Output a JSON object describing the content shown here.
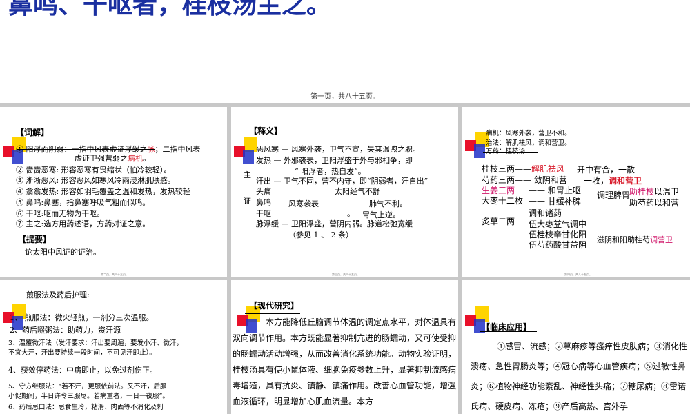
{
  "top": {
    "title": "鼻鸣、干呕者，桂枝汤主之。",
    "page": "第一页，共八十五页。"
  },
  "slide2": {
    "heading": "【词解】",
    "l1a": "① 阳浮而阴弱：一指中风表虚证浮缓之",
    "l1b": "脉",
    "l1c": "；二指中风表",
    "l2a": "虚证卫强营弱之",
    "l2b": "病机",
    "l2c": "。",
    "l3": "② 啬啬恶寒:     形容恶寒有畏缩状（怕冷较轻）。",
    "l4": "③ 淅淅恶风:     形容恶风如寒风冷雨浸淋肌肤感。",
    "l5": "④ 翕翕发热:     形容如羽毛覆盖之温和发热，发热较轻",
    "l6": "⑤ 鼻鸣:鼻塞，指鼻塞呼吸气粗而似鸣。",
    "l7": "⑥ 干呕:呕而无物为干呕。",
    "l8": "⑦ 主之:选方用药述语，方药对证之意。",
    "heading2": "【提要】",
    "l9": "论太阳中风证的证治。",
    "foot": "第二页，共八十五页。"
  },
  "slide3": {
    "heading": "【释义】",
    "zhu": "主",
    "zheng": "证",
    "r1": "恶风寒 — 风寒外袭，卫气不宣，失其温煦之职。",
    "r2": "发热  — 外邪袭表，卫阳浮盛于外与邪相争，即",
    "r3": "“ 阳浮者，热自发”。",
    "r4": "汗出 — 卫气不固，营不内守，即“阴弱者，汗自出”",
    "r5a": "头痛",
    "r5b": "太阳经气不舒",
    "r6a": "鼻鸣",
    "r6b": "风寒袭表",
    "r6c": "肺气不利。",
    "r7a": "干呕",
    "r7b": "。",
    "r7c": "胃气上逆。",
    "r8": "脉浮缓 — 卫阳浮盛，营阴内弱。脉道松弛宽缓",
    "r9": "（参见 1 、 2 条）",
    "foot": "第三页，共八十五页。"
  },
  "slide4": {
    "n1": "病机：风寒外袭，营卫不和。",
    "n2": "治法：解肌祛风，调和营卫。",
    "n3": "方药：桂枝汤",
    "a1": "桂枝三两——",
    "a1r": "解肌祛风",
    "a1c": "开中有合，一散",
    "a2": "芍药三两—— 敛阴和营",
    "a2c": "一收，",
    "a2r": "调和营卫",
    "a3p": "生姜三两",
    "a3": "—— 和胃止呕",
    "a3c": "调理脾胃",
    "a3r": "助桂枝",
    "a3d": "以温卫",
    "a4": "大枣十二枚",
    "a4b": "—— 甘缓补脾",
    "a4c": "助芍药以和营",
    "a5": "调和诸药",
    "a6": "炙草二两",
    "a7": "伍大枣益气调中",
    "a8": "伍桂枝辛甘化阳",
    "a9": "伍芍药酸甘益阴",
    "a10": "滋阴和阳助桂芍",
    "a10r": "调营卫",
    "foot": "第四页，共八十五页。"
  },
  "slide5": {
    "heading": "煎服法及药后护理:",
    "b1": "1、 煎服法：微火轻煎，一剂分三次温服。",
    "b2": "2、药后啜粥法：助药力，资汗源",
    "b3a": "3、温覆微汗法（发汗要求：汗出要周遍，要发小汗、微汗，",
    "b3b": "不宜大汗，汗出要持续一段时间，不可见汗即止）。",
    "b4": "4、获效停药法：中病即止，以免过剂伤正。",
    "b5a": "5、守方继服法：“若不汗，更服依前法。又不汗，后服",
    "b5b": "小促期间，半日许令三服尽。若病重者，一日一夜服”。",
    "b6": "6、药后忌口法：忌食生冷，粘滑、肉面等不消化及刺"
  },
  "slide6": {
    "heading": "【现代研究】",
    "body": "本方能降低丘脑调节体温的调定点水平，对体温具有双向调节作用。本方既能显著抑制亢进的肠蠕动，又可使受抑的肠蠕动活动增强，从而改善消化系统功能。动物实验证明，桂枝汤具有使小鼠体液、细胞免疫参数上升，显著抑制流感病毒增殖，具有抗炎、镇静、镇痛作用。改善心血管功能，增强血液循环，明显增加心肌血流量。本方"
  },
  "slide7": {
    "heading": "【临床应用】",
    "body": "①感冒、流感；②荨麻疹等瘙痒性皮肤病；③消化性溃疡、急性胃肠炎等；④冠心病等心血管疾病；⑤过敏性鼻炎；⑥植物神经功能紊乱、神经性头痛；⑦糖尿病；⑧雷诺氏病、硬皮病、冻疮；⑨产后高热、宫外孕"
  }
}
